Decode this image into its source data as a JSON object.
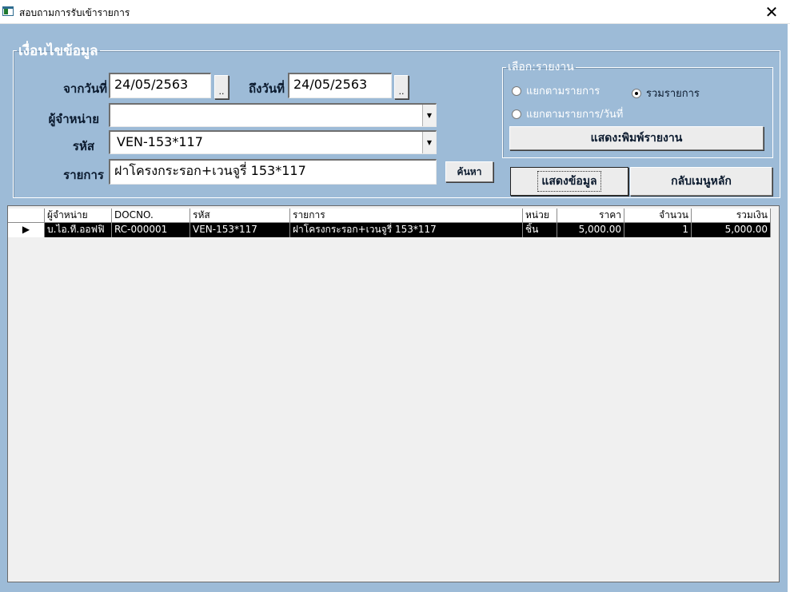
{
  "window": {
    "title": "สอบถามการรับเข้ารายการ",
    "close_glyph": "✕"
  },
  "conditions": {
    "legend": "เงื่อนไขข้อมูล",
    "from_date_label": "จากวันที่",
    "from_date": "24/05/2563",
    "to_date_label": "ถึงวันที่",
    "to_date": "24/05/2563",
    "date_button": "..",
    "vendor_label": "ผู้จำหน่าย",
    "vendor_value": "",
    "code_label": "รหัส",
    "code_value": "VEN-153*117",
    "item_label": "รายการ",
    "item_value": "ฝาโครงกระรอก+เวนจูรี่ 153*117",
    "search_button": "ค้นหา",
    "dropdown_glyph": "▼"
  },
  "report": {
    "legend": "เลือก:รายงาน",
    "options": [
      {
        "label": "แยกตามรายการ",
        "selected": false
      },
      {
        "label": "รวมรายการ",
        "selected": true
      },
      {
        "label": "แยกตามรายการ/วันที่",
        "selected": false
      }
    ],
    "print_button": "แสดง:พิมพ์รายงาน"
  },
  "actions": {
    "show_data_button": "แสดงข้อมูล",
    "main_menu_button": "กลับเมนูหลัก"
  },
  "grid": {
    "columns": [
      "ผู้จำหน่าย",
      "DOCNO.",
      "รหัส",
      "รายการ",
      "หน่วย",
      "ราคา",
      "จำนวน",
      "รวมเงิน"
    ],
    "row_pointer": "▶",
    "rows": [
      [
        "บ.ไอ.ที.ออฟฟิ",
        "RC-000001",
        "VEN-153*117",
        "ฝาโครงกระรอก+เวนจูรี่ 153*117",
        "ชิ้น",
        "5,000.00",
        "1",
        "5,000.00"
      ]
    ]
  }
}
